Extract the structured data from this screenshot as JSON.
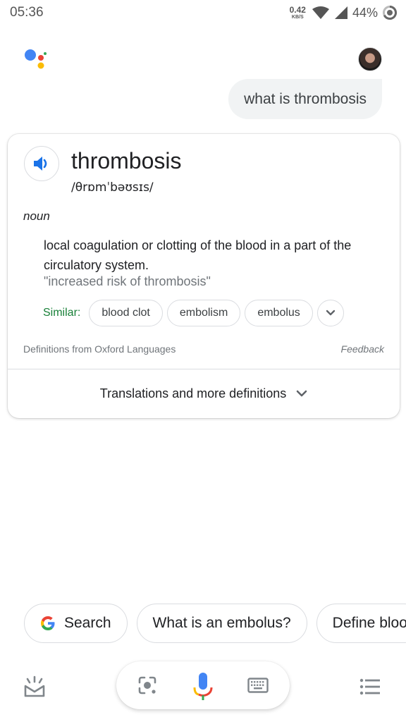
{
  "status_bar": {
    "time": "05:36",
    "net_speed_value": "0.42",
    "net_speed_unit": "KB/S",
    "battery_percent": "44%",
    "icons": [
      "wifi-icon",
      "signal-icon",
      "battery-icon"
    ]
  },
  "conversation": {
    "assistant_logo": "google-assistant-logo",
    "user_query": "what is thrombosis"
  },
  "definition_card": {
    "word": "thrombosis",
    "phonetic": "/θrɒmˈbəʊsɪs/",
    "part_of_speech": "noun",
    "definition": "local coagulation or clotting of the blood in a part of the circulatory system.",
    "example": "\"increased risk of thrombosis\"",
    "similar_label": "Similar:",
    "similar": [
      "blood clot",
      "embolism",
      "embolus"
    ],
    "source": "Definitions from Oxford Languages",
    "feedback": "Feedback",
    "more_label": "Translations and more definitions"
  },
  "suggestions": [
    {
      "label": "Search",
      "icon": "google-g-icon"
    },
    {
      "label": "What is an embolus?"
    },
    {
      "label": "Define bloo"
    }
  ],
  "bottom_bar": {
    "left_icon": "updates-tray-icon",
    "center_icons": [
      "lens-icon",
      "mic-icon",
      "keyboard-icon"
    ],
    "right_icon": "list-icon"
  },
  "colors": {
    "google_blue": "#4285F4",
    "google_red": "#EA4335",
    "google_yellow": "#FBBC05",
    "google_green": "#34A853",
    "similar_green": "#188038",
    "speaker_blue": "#1A73E8"
  }
}
